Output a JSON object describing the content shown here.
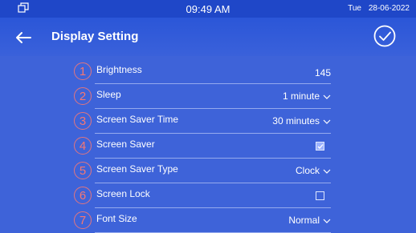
{
  "status": {
    "time": "09:49 AM",
    "day": "Tue",
    "date": "28-06-2022"
  },
  "header": {
    "title": "Display Setting"
  },
  "settings": [
    {
      "num": "1",
      "label": "Brightness",
      "value": "145",
      "kind": "value"
    },
    {
      "num": "2",
      "label": "Sleep",
      "value": "1 minute",
      "kind": "select"
    },
    {
      "num": "3",
      "label": "Screen Saver Time",
      "value": "30 minutes",
      "kind": "select"
    },
    {
      "num": "4",
      "label": "Screen Saver",
      "checked": true,
      "kind": "checkbox"
    },
    {
      "num": "5",
      "label": "Screen Saver Type",
      "value": "Clock",
      "kind": "select"
    },
    {
      "num": "6",
      "label": "Screen Lock",
      "checked": false,
      "kind": "checkbox"
    },
    {
      "num": "7",
      "label": "Font Size",
      "value": "Normal",
      "kind": "select"
    }
  ],
  "colors": {
    "background": "#3e63d9",
    "statusbar": "#1f47c8",
    "annotation": "#ff786e"
  }
}
